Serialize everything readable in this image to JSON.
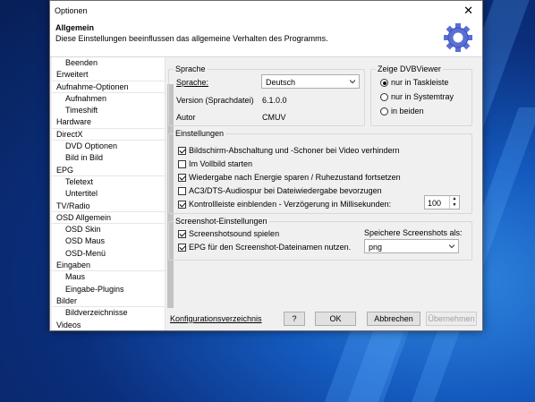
{
  "window": {
    "title": "Optionen",
    "close_glyph": "✕"
  },
  "header": {
    "title": "Allgemein",
    "subtitle": "Diese Einstellungen beeinflussen das allgemeine Verhalten des Programms.",
    "icon": "gear-icon"
  },
  "tree": [
    {
      "label": "Beenden",
      "level": 1
    },
    {
      "label": "Erweitert",
      "level": 0
    },
    {
      "label": "Aufnahme-Optionen",
      "level": 0
    },
    {
      "label": "Aufnahmen",
      "level": 1
    },
    {
      "label": "Timeshift",
      "level": 1
    },
    {
      "label": "Hardware",
      "level": 0
    },
    {
      "label": "DirectX",
      "level": 0
    },
    {
      "label": "DVD Optionen",
      "level": 1
    },
    {
      "label": "Bild in Bild",
      "level": 1
    },
    {
      "label": "EPG",
      "level": 0
    },
    {
      "label": "Teletext",
      "level": 1
    },
    {
      "label": "Untertitel",
      "level": 1
    },
    {
      "label": "TV/Radio",
      "level": 0
    },
    {
      "label": "OSD Allgemein",
      "level": 0
    },
    {
      "label": "OSD Skin",
      "level": 1
    },
    {
      "label": "OSD Maus",
      "level": 1
    },
    {
      "label": "OSD-Menü",
      "level": 1
    },
    {
      "label": "Eingaben",
      "level": 0
    },
    {
      "label": "Maus",
      "level": 1
    },
    {
      "label": "Eingabe-Plugins",
      "level": 1
    },
    {
      "label": "Bilder",
      "level": 0
    },
    {
      "label": "Bildverzeichnisse",
      "level": 1
    },
    {
      "label": "Videos",
      "level": 0
    }
  ],
  "sprache": {
    "group_label": "Sprache",
    "sprache_label": "Sprache:",
    "sprache_value": "Deutsch",
    "version_label": "Version (Sprachdatei)",
    "version_value": "6.1.0.0",
    "autor_label": "Autor",
    "autor_value": "CMUV"
  },
  "zeige": {
    "group_label": "Zeige DVBViewer",
    "options": [
      {
        "label": "nur in Taskleiste",
        "checked": true
      },
      {
        "label": "nur in Systemtray",
        "checked": false
      },
      {
        "label": "in beiden",
        "checked": false
      }
    ]
  },
  "einstellungen": {
    "group_label": "Einstellungen",
    "items": [
      {
        "label": "Bildschirm-Abschaltung und -Schoner bei Video verhindern",
        "checked": true
      },
      {
        "label": "Im Vollbild starten",
        "checked": false
      },
      {
        "label": "Wiedergabe nach Energie sparen / Ruhezustand fortsetzen",
        "checked": true
      },
      {
        "label": "AC3/DTS-Audiospur bei Dateiwiedergabe bevorzugen",
        "checked": false
      },
      {
        "label": "Kontrollleiste einblenden - Verzögerung in Millisekunden:",
        "checked": true
      }
    ],
    "delay_value": "100"
  },
  "screenshot": {
    "group_label": "Screenshot-Einstellungen",
    "items": [
      {
        "label": "Screenshotsound spielen",
        "checked": true
      },
      {
        "label": "EPG für den Screenshot-Dateinamen nutzen.",
        "checked": true
      }
    ],
    "format_label": "Speichere Screenshots als:",
    "format_value": "png"
  },
  "footer": {
    "link": "Konfigurationsverzeichnis",
    "help": "?",
    "ok": "OK",
    "cancel": "Abbrechen",
    "apply": "Übernehmen"
  }
}
